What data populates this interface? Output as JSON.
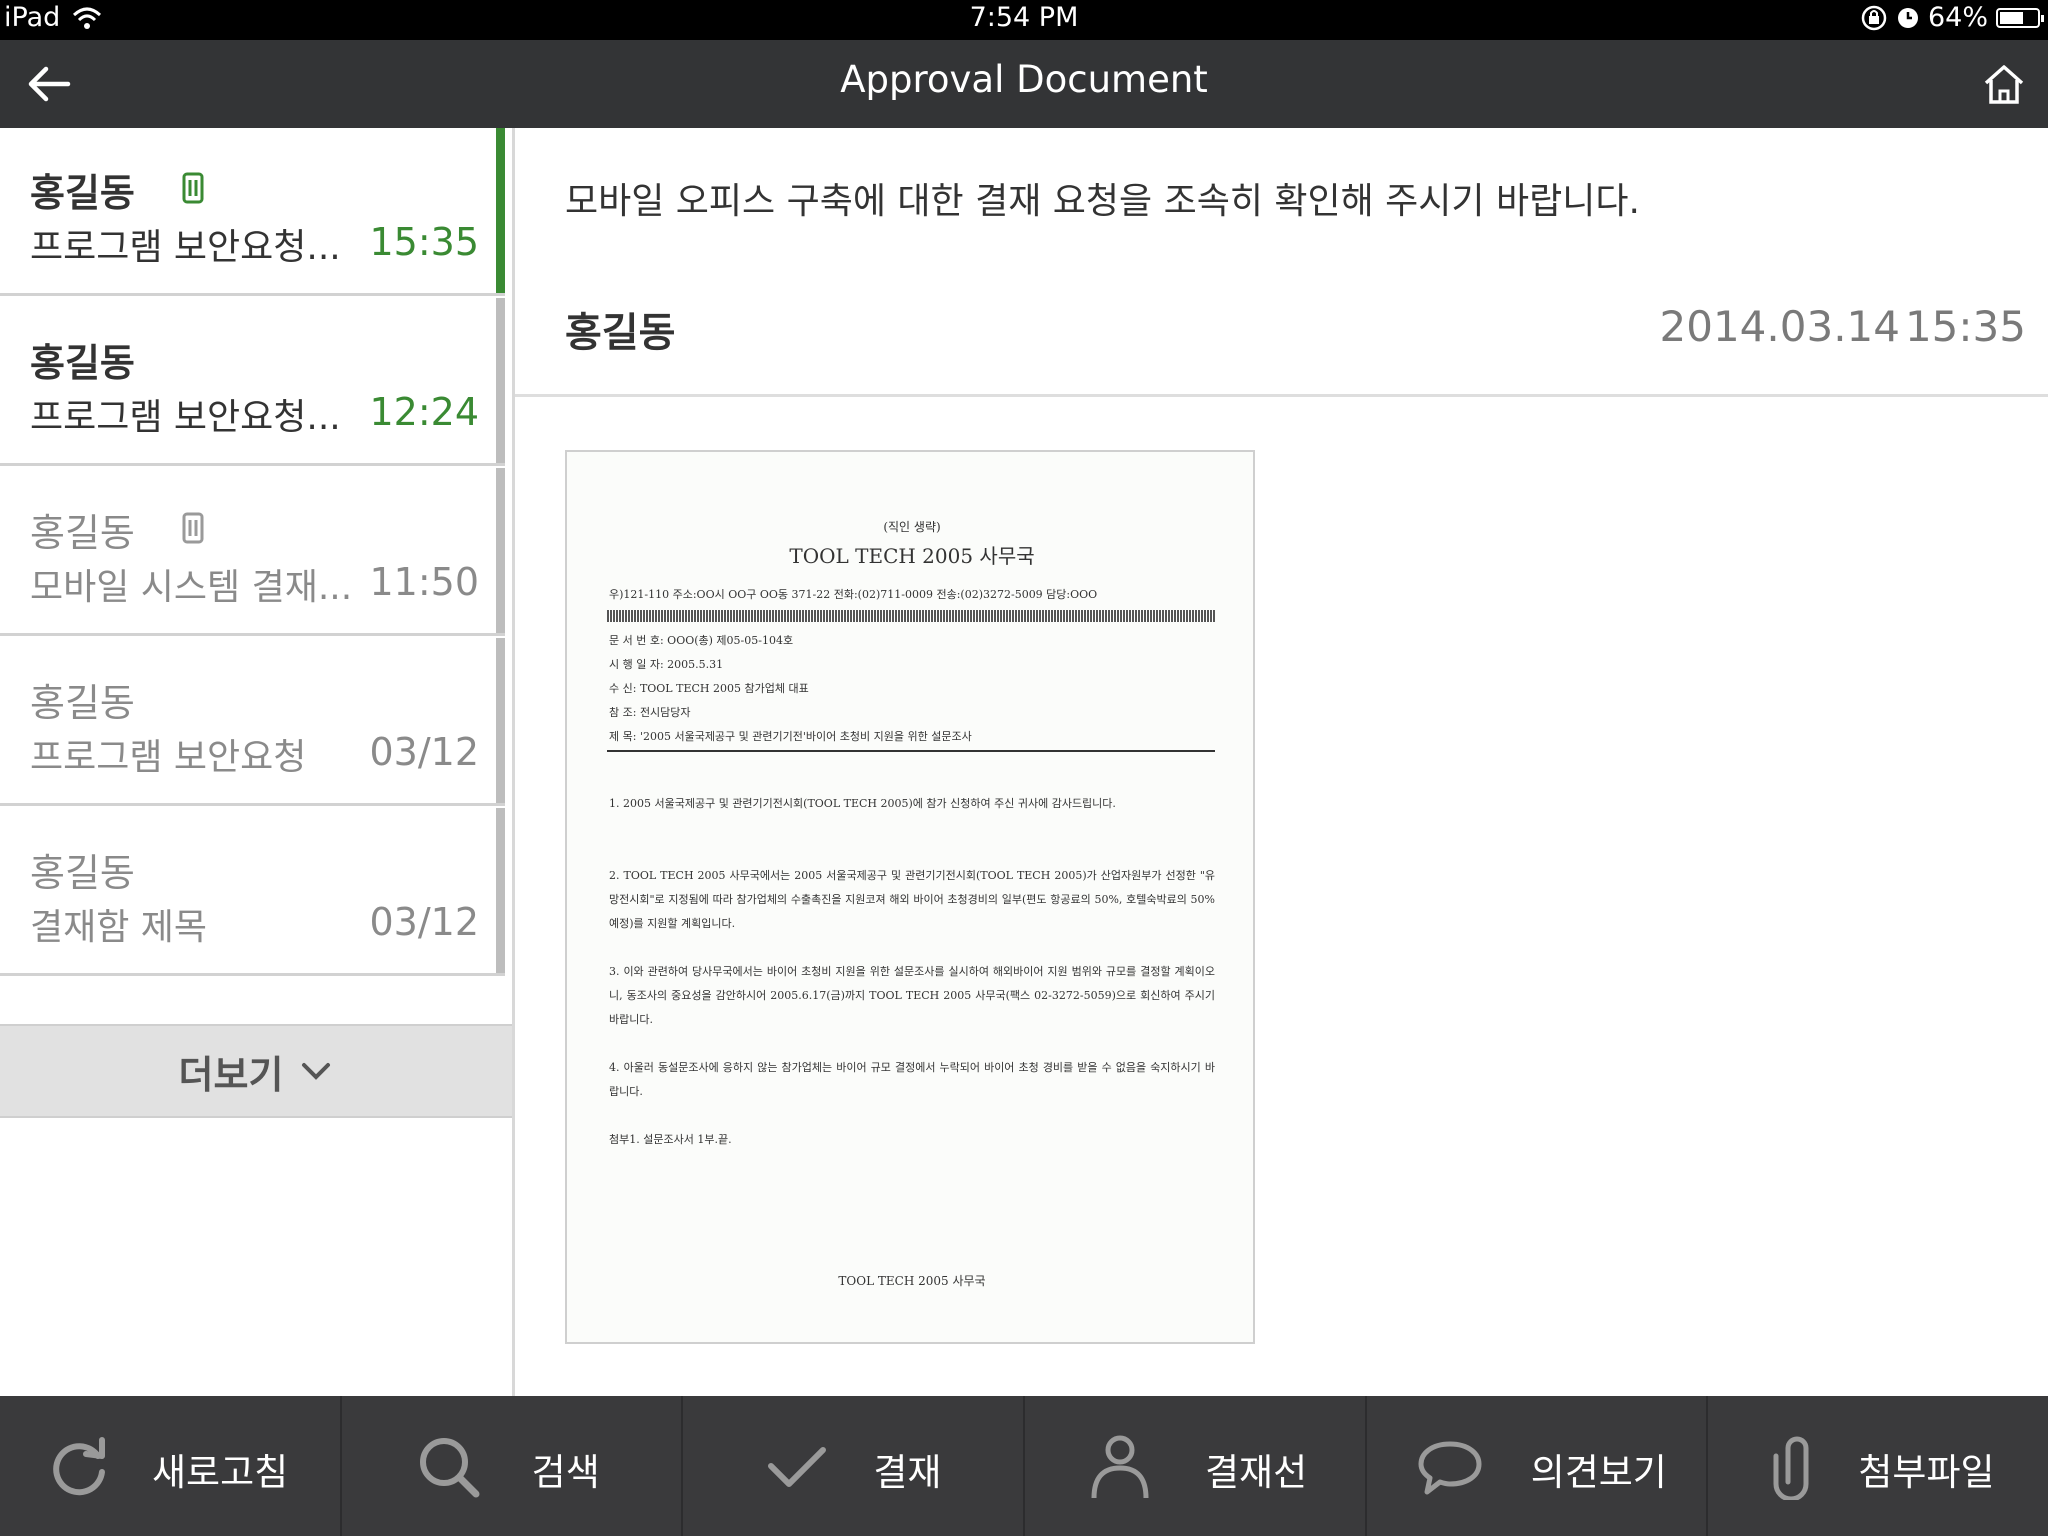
{
  "status_bar": {
    "device": "iPad",
    "time": "7:54 PM",
    "battery": "64%",
    "battery_level": 0.64
  },
  "header": {
    "title": "Approval Document"
  },
  "list": {
    "items": [
      {
        "name": "홍길동",
        "subject": "프로그램 보안요청...",
        "time": "15:35",
        "attachment": true,
        "read": false
      },
      {
        "name": "홍길동",
        "subject": "프로그램 보안요청...",
        "time": "12:24",
        "attachment": false,
        "read": false
      },
      {
        "name": "홍길동",
        "subject": "모바일 시스템 결재...",
        "time": "11:50",
        "attachment": true,
        "read": true
      },
      {
        "name": "홍길동",
        "subject": "프로그램 보안요청",
        "time": "03/12",
        "attachment": false,
        "read": true
      },
      {
        "name": "홍길동",
        "subject": "결재함 제목",
        "time": "03/12",
        "attachment": false,
        "read": true
      }
    ],
    "more_label": "더보기"
  },
  "detail": {
    "message": "모바일 오피스 구축에 대한 결재 요청을 조속히 확인해 주시기 바랍니다.",
    "sender": "홍길동",
    "date": "2014.03.14",
    "time": "15:35"
  },
  "document": {
    "header_small": "(직인 생략)",
    "org": "TOOL TECH 2005 사무국",
    "address": "우)121-110  주소:OO시 OO구 OO동 371-22  전화:(02)711-0009  전송:(02)3272-5009 담당:OOO",
    "meta": [
      "문 서 번 호: OOO(총) 제05-05-104호",
      "시 행 일 자: 2005.5.31",
      "수         신: TOOL TECH 2005 참가업체 대표",
      "참         조: 전시담당자",
      "제         목: '2005 서울국제공구 및 관련기기전'바이어 초청비 지원을 위한 설문조사"
    ],
    "paragraphs": [
      "1. 2005 서울국제공구 및 관련기기전시회(TOOL TECH 2005)에 참가 신청하여 주신 귀사에 감사드립니다.",
      "2. TOOL TECH 2005 사무국에서는 2005 서울국제공구 및 관련기기전시회(TOOL TECH 2005)가 산업자원부가 선정한 \"유망전시회\"로 지정됨에 따라 참가업체의 수출촉진을 지원코져 해외 바이어 초청경비의 일부(편도 항공료의 50%, 호텔숙박료의 50% 예정)를 지원할 계획입니다.",
      "3. 이와 관련하여 당사무국에서는 바이어 초청비 지원을 위한 설문조사를 실시하여 해외바이어 지원 범위와 규모를 결정할 계획이오니, 동조사의 중요성을 감안하시어 2005.6.17(금)까지 TOOL TECH 2005 사무국(팩스 02-3272-5059)으로 회신하여 주시기 바랍니다.",
      "4. 아울러 동설문조사에 응하지 않는 참가업체는 바이어 규모 결정에서 누락되어 바이어 초청 경비를 받을 수 없음을 숙지하시기 바랍니다.",
      "첨부1. 설문조사서 1부.끝."
    ],
    "footer": "TOOL TECH 2005 사무국"
  },
  "toolbar": {
    "refresh": "새로고침",
    "search": "검색",
    "approve": "결재",
    "approval_line": "결재선",
    "comments": "의견보기",
    "attachments": "첨부파일"
  },
  "colors": {
    "accent_green": "#3a8a33",
    "bar_dark": "#333436",
    "toolbar": "#3a3a3c"
  }
}
